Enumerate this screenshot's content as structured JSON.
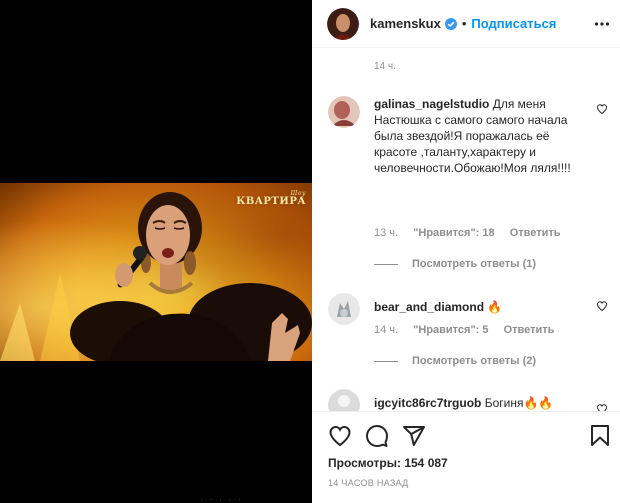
{
  "video": {
    "watermark_small": "Шоу",
    "watermark_main": "КВАРТИРА",
    "bottom_hint": "·  ·  ·  ·  ·"
  },
  "header": {
    "username": "kamenskux",
    "separator": "•",
    "follow_label": "Подписаться"
  },
  "comments": {
    "top_time": "14 ч.",
    "items": [
      {
        "username": "galinas_nagelstudio",
        "text": "Для меня Настюшка с самого самого начала была звездой!Я поражалась её красоте ,талантy,характеру и человечности.Обожаю!Моя ляля!!!!",
        "time": "13 ч.",
        "likes": "\"Нравится\": 18",
        "reply_label": "Ответить",
        "replies": "Посмотреть ответы (1)"
      },
      {
        "username": "bear_and_diamond",
        "text": "🔥",
        "time": "14 ч.",
        "likes": "\"Нравится\": 5",
        "reply_label": "Ответить",
        "replies": "Посмотреть ответы (2)"
      },
      {
        "username": "igcyitc86rc7trguob",
        "text": "Богиня🔥🔥"
      }
    ]
  },
  "stats": {
    "views": "Просмотры: 154 087",
    "time_ago": "14 ЧАСОВ НАЗАД"
  },
  "colors": {
    "accent": "#0095f6",
    "muted": "#8e8e8e",
    "text": "#262626"
  }
}
